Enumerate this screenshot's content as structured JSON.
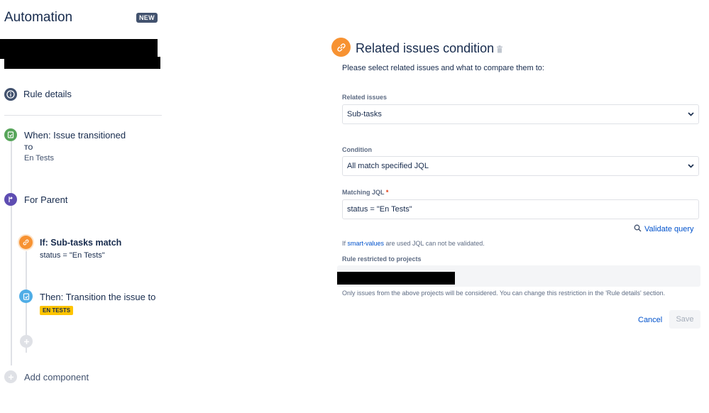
{
  "app": {
    "title": "Automation",
    "badge": "NEW"
  },
  "sidebar": {
    "rule_details": "Rule details",
    "trigger": {
      "title": "When: Issue transitioned",
      "to_label": "TO",
      "to_value": "En Tests"
    },
    "branch": {
      "title": "For Parent"
    },
    "condition": {
      "title": "If: Sub-tasks match",
      "value": "status = \"En Tests\""
    },
    "action": {
      "title": "Then: Transition the issue to",
      "status_lozenge": "EN TESTS"
    },
    "add_component": "Add component"
  },
  "panel": {
    "title": "Related issues condition",
    "intro": "Please select related issues and what to compare them to:",
    "related_issues": {
      "label": "Related issues",
      "value": "Sub-tasks"
    },
    "condition": {
      "label": "Condition",
      "value": "All match specified JQL"
    },
    "matching_jql": {
      "label": "Matching JQL",
      "required_mark": "*",
      "value": "status = \"En Tests\""
    },
    "validate_query": "Validate query",
    "smart_note": {
      "prefix": "If ",
      "link": "smart-values",
      "suffix": " are used JQL can not be validated."
    },
    "restricted": {
      "label": "Rule restricted to projects",
      "note": "Only issues from the above projects will be considered. You can change this restriction in the 'Rule details' section."
    },
    "buttons": {
      "cancel": "Cancel",
      "save": "Save"
    }
  },
  "icons": {
    "rule_details": "info-icon",
    "trigger": "transition-icon",
    "branch": "branch-icon",
    "condition": "link-icon",
    "action": "transition-icon",
    "add": "plus-icon",
    "delete": "trash-icon",
    "validate": "search-icon",
    "dropdown": "chevron-down-icon"
  },
  "colors": {
    "trigger": "#57a55a",
    "branch": "#5e4db2",
    "condition": "#f79232",
    "action": "#4fade6",
    "link": "#0052cc",
    "lozenge": "#ffc400"
  }
}
